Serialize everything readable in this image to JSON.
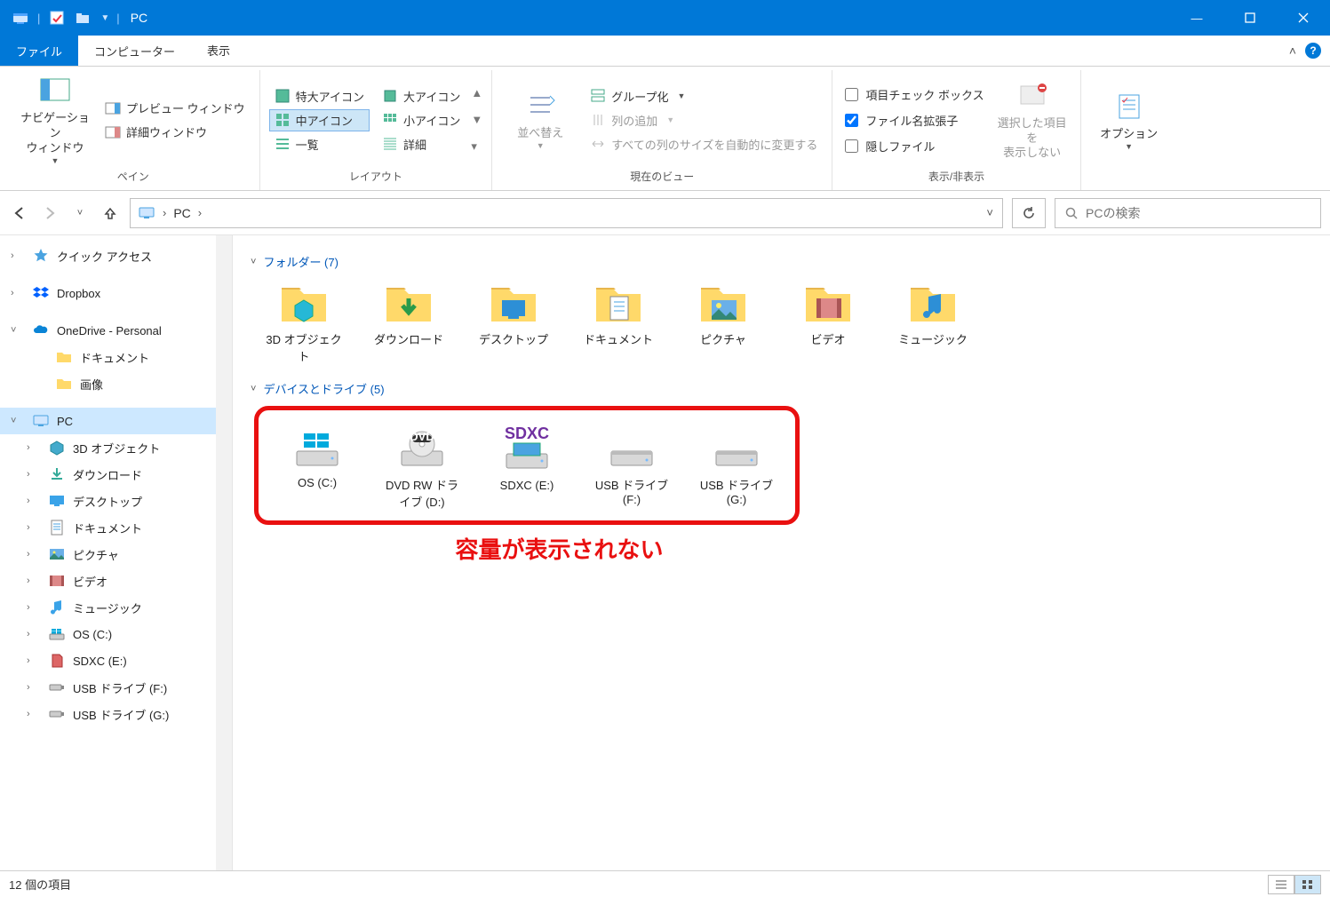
{
  "window": {
    "title": "PC",
    "minimize": "—",
    "maximize": "▢",
    "close": "✕"
  },
  "ribbon": {
    "tabs": {
      "file": "ファイル",
      "computer": "コンピューター",
      "view": "表示"
    },
    "collapse": "˄",
    "groups": {
      "panes": {
        "label": "ペイン",
        "nav": "ナビゲーション\nウィンドウ",
        "preview": "プレビュー ウィンドウ",
        "details": "詳細ウィンドウ"
      },
      "layout": {
        "label": "レイアウト",
        "xl": "特大アイコン",
        "l": "大アイコン",
        "m": "中アイコン",
        "s": "小アイコン",
        "list": "一覧",
        "detail": "詳細"
      },
      "currentview": {
        "label": "現在のビュー",
        "sort": "並べ替え",
        "group": "グループ化",
        "addcol": "列の追加",
        "autosize": "すべての列のサイズを自動的に変更する"
      },
      "showhide": {
        "label": "表示/非表示",
        "chk_itemcheck": "項目チェック ボックス",
        "chk_ext": "ファイル名拡張子",
        "chk_hidden": "隠しファイル",
        "hidesel": "選択した項目を\n表示しない"
      },
      "options": {
        "label": "オプション"
      }
    }
  },
  "nav": {
    "back": "←",
    "forward": "→",
    "hist": "˅",
    "up": "↑",
    "location": "PC",
    "chevron": "›",
    "refresh": "⟳",
    "search_placeholder": "PCの検索"
  },
  "sidebar": {
    "quickaccess": "クイック アクセス",
    "dropbox": "Dropbox",
    "onedrive": "OneDrive - Personal",
    "od_docs": "ドキュメント",
    "od_pics": "画像",
    "pc": "PC",
    "pc_3d": "3D オブジェクト",
    "pc_dl": "ダウンロード",
    "pc_desk": "デスクトップ",
    "pc_docs": "ドキュメント",
    "pc_pics": "ピクチャ",
    "pc_vid": "ビデオ",
    "pc_music": "ミュージック",
    "pc_osc": "OS (C:)",
    "pc_sdxc": "SDXC (E:)",
    "pc_usbf": "USB ドライブ (F:)",
    "pc_usbg": "USB ドライブ (G:)"
  },
  "content": {
    "folders_header": "フォルダー (7)",
    "drives_header": "デバイスとドライブ (5)",
    "folders": {
      "obj3d": "3D オブジェクト",
      "download": "ダウンロード",
      "desktop": "デスクトップ",
      "documents": "ドキュメント",
      "pictures": "ピクチャ",
      "video": "ビデオ",
      "music": "ミュージック"
    },
    "drives": {
      "c": "OS (C:)",
      "d": "DVD RW ドライブ (D:)",
      "e": "SDXC (E:)",
      "f": "USB ドライブ (F:)",
      "g": "USB ドライブ (G:)",
      "sdxc_badge": "SDXC"
    },
    "annotation": "容量が表示されない"
  },
  "status": {
    "items": "12 個の項目"
  }
}
